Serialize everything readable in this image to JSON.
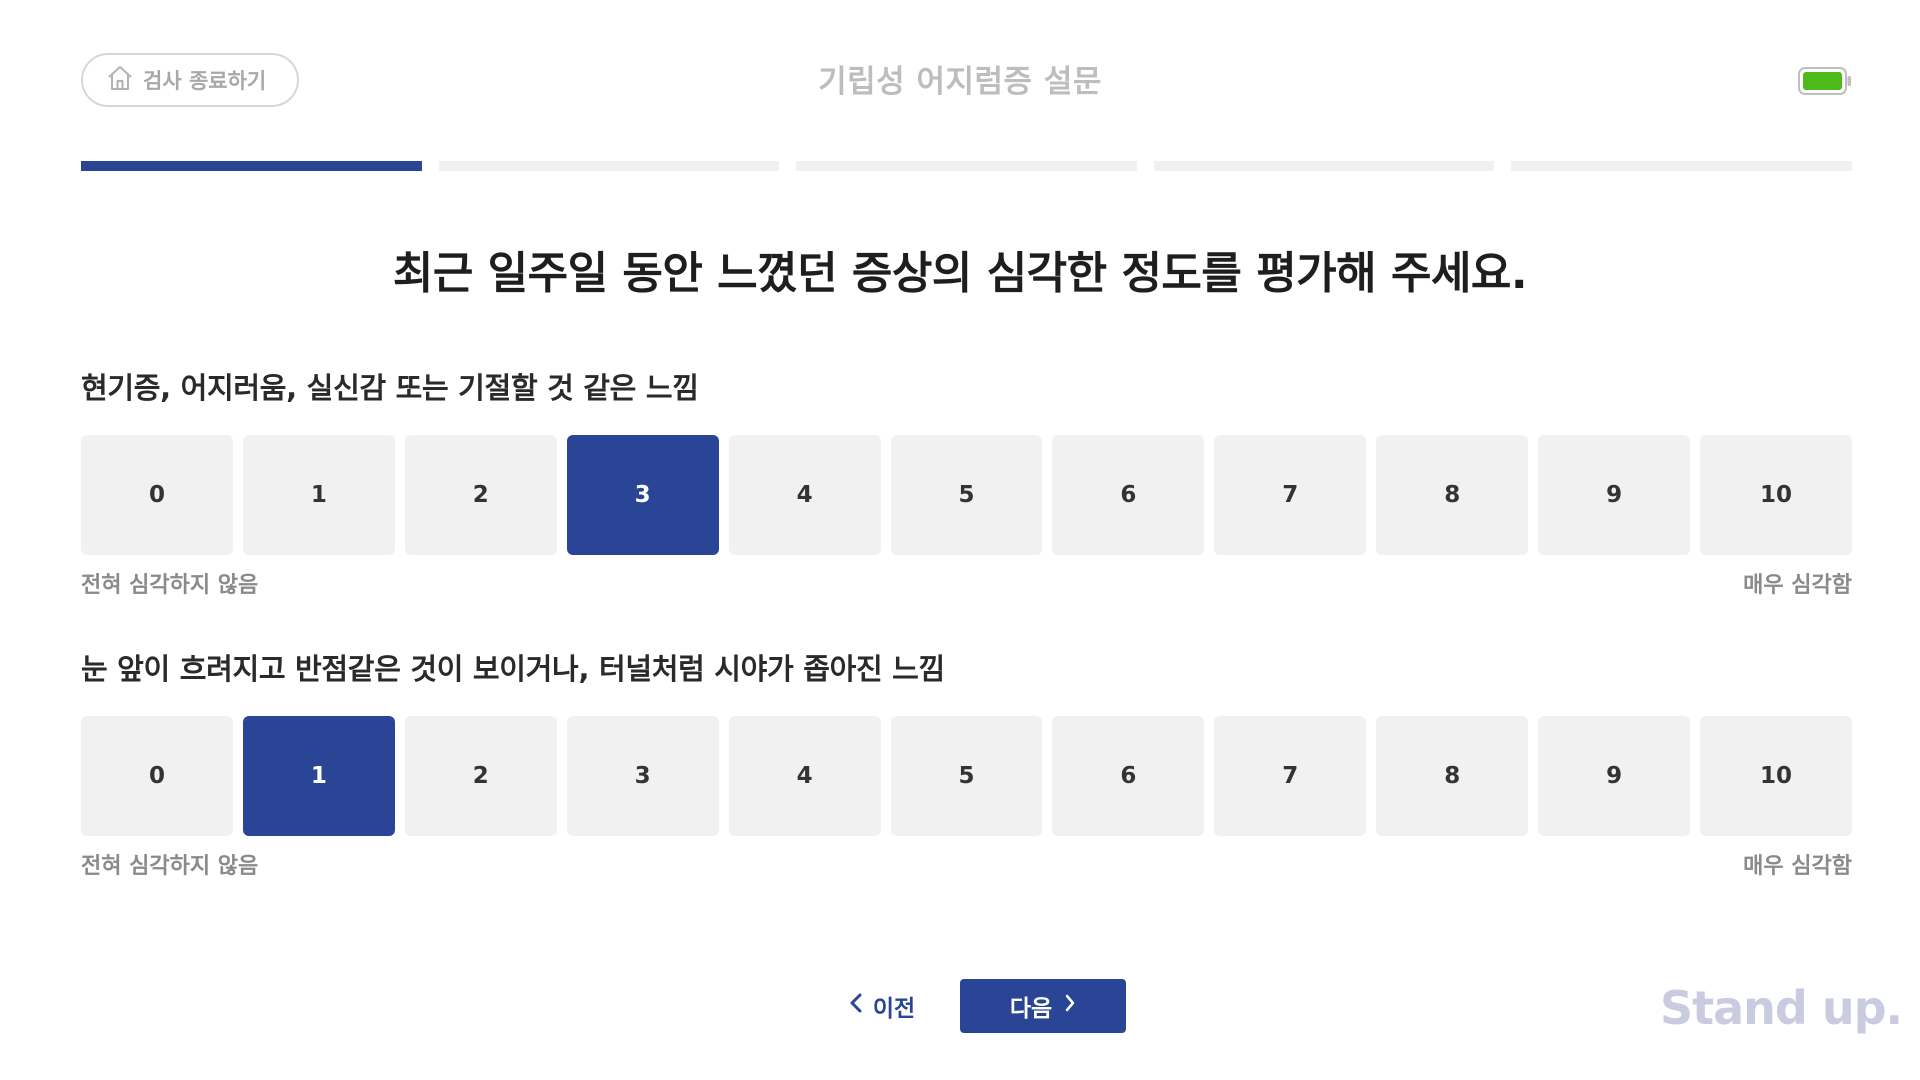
{
  "header": {
    "exit_label": "검사 종료하기",
    "title": "기립성 어지럼증 설문",
    "battery_color": "#4cbb17"
  },
  "progress": {
    "total_steps": 5,
    "current_step": 1
  },
  "instruction": "최근 일주일 동안 느꼈던 증상의 심각한 정도를 평가해 주세요.",
  "questions": [
    {
      "label": "현기증, 어지러움, 실신감 또는 기절할 것 같은 느낌",
      "options": [
        "0",
        "1",
        "2",
        "3",
        "4",
        "5",
        "6",
        "7",
        "8",
        "9",
        "10"
      ],
      "selected": "3",
      "min_label": "전혀 심각하지 않음",
      "max_label": "매우 심각함"
    },
    {
      "label": "눈 앞이 흐려지고 반점같은 것이 보이거나, 터널처럼 시야가 좁아진 느낌",
      "options": [
        "0",
        "1",
        "2",
        "3",
        "4",
        "5",
        "6",
        "7",
        "8",
        "9",
        "10"
      ],
      "selected": "1",
      "min_label": "전혀 심각하지 않음",
      "max_label": "매우 심각함"
    }
  ],
  "nav": {
    "prev_label": "이전",
    "next_label": "다음"
  },
  "brand": {
    "logo_text": "Stand up."
  },
  "colors": {
    "accent": "#2a4595",
    "option_bg": "#f1f1f1",
    "muted_text": "#8a8a8a"
  },
  "icons": {
    "exit": "home-icon",
    "prev": "chevron-left-icon",
    "next": "chevron-right-icon",
    "status": "battery-icon"
  }
}
